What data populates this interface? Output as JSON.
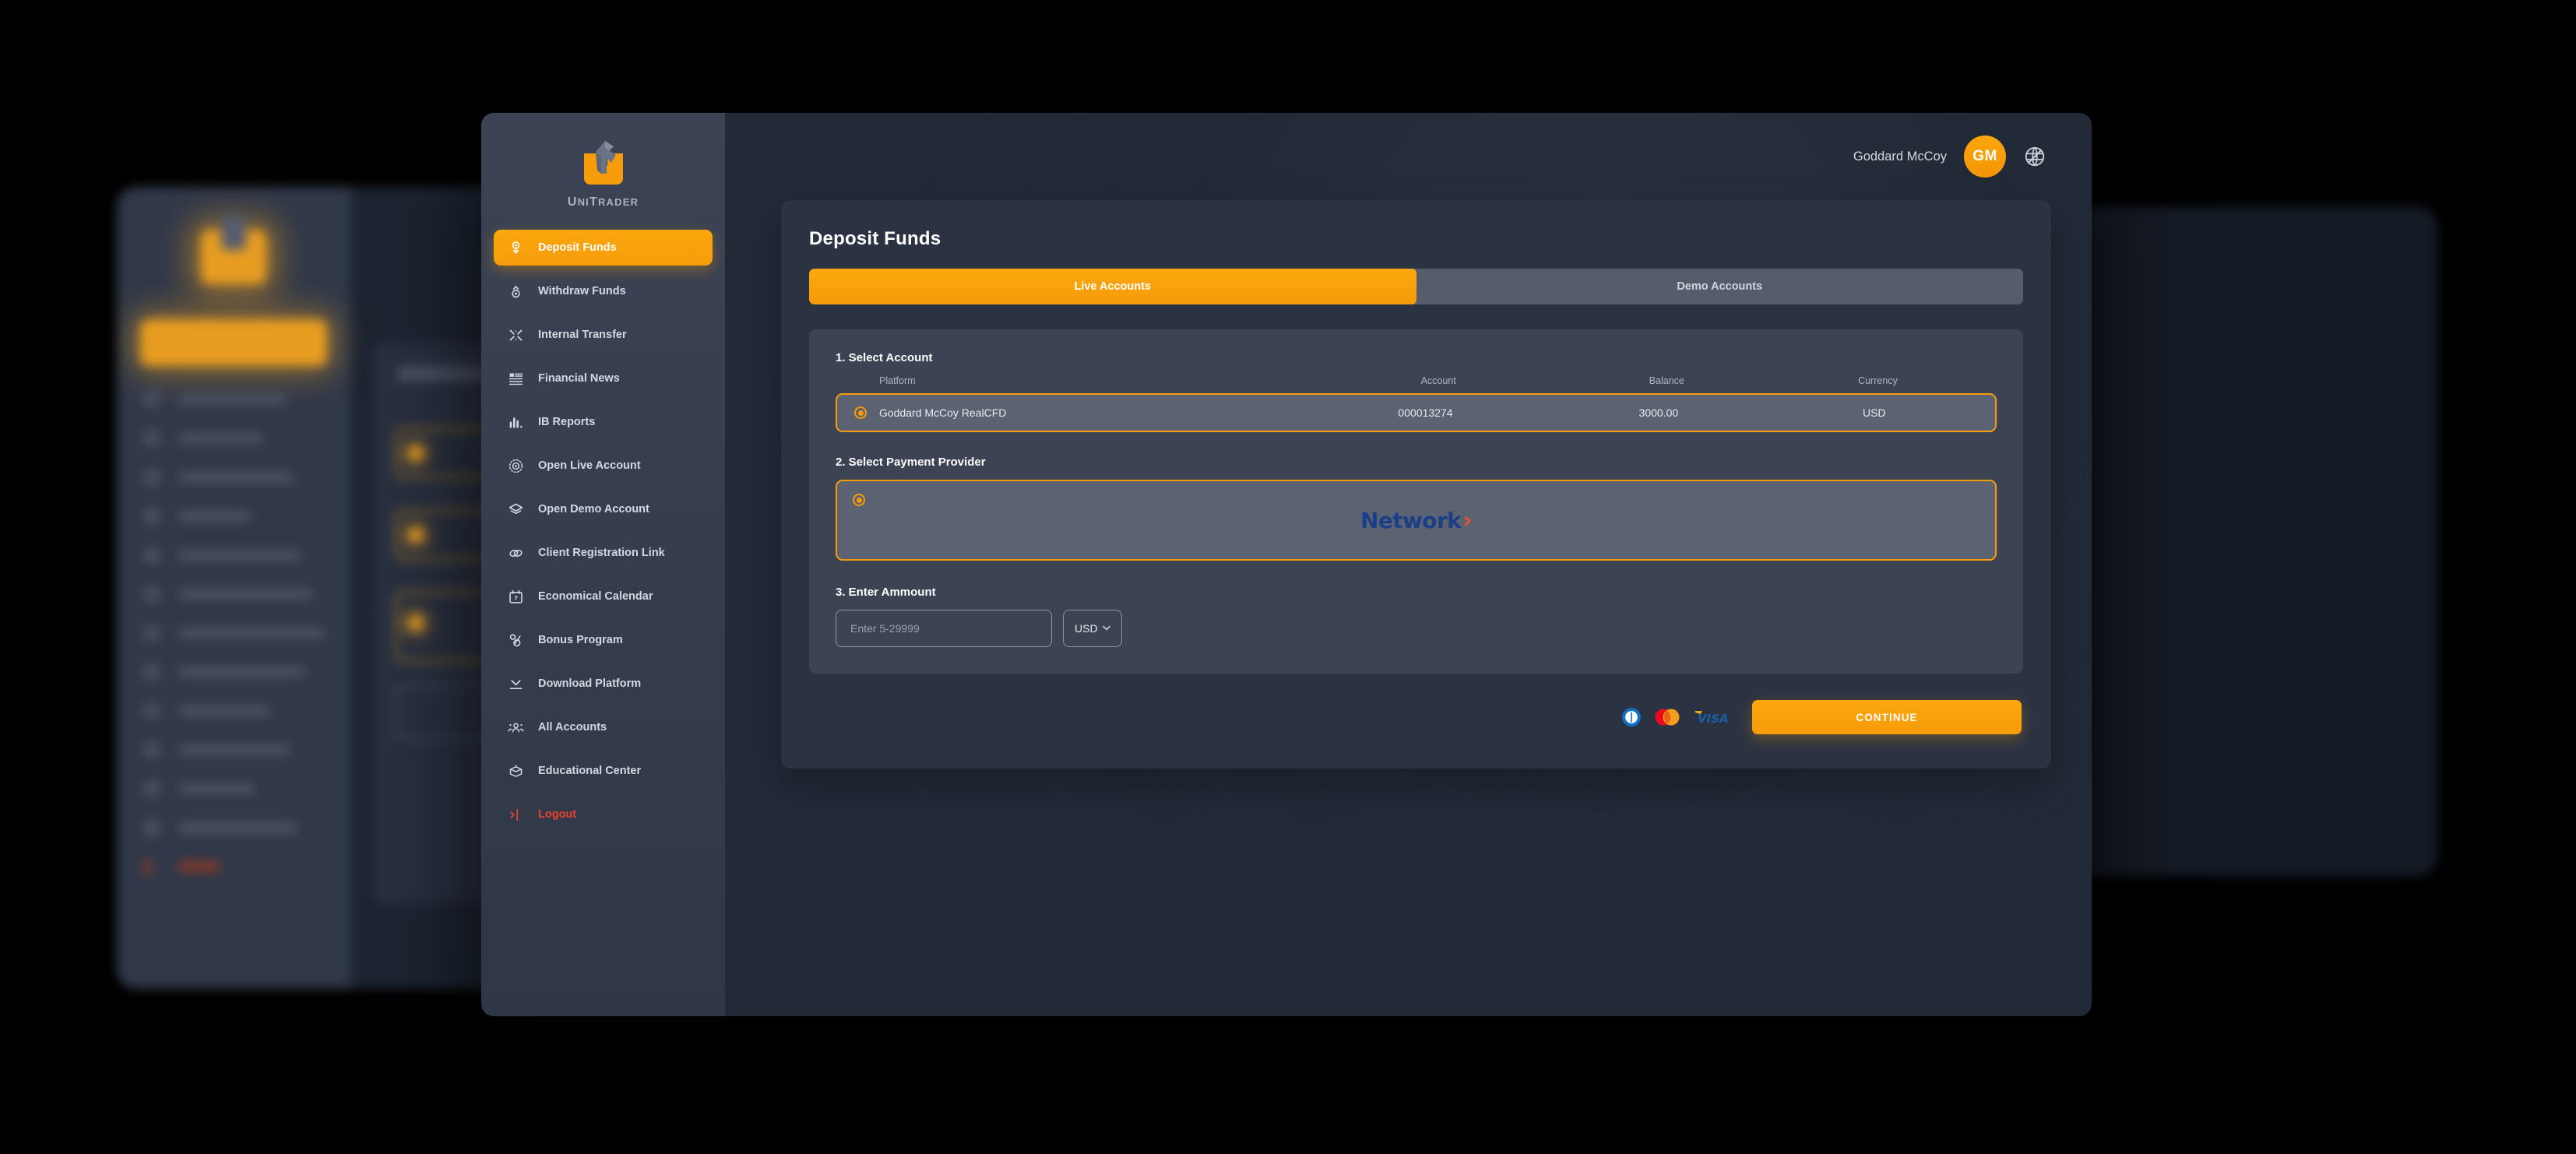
{
  "brand": {
    "name_upper_u": "U",
    "name_ni": "NI",
    "name_t": "T",
    "name_rader": "RADER",
    "full": "UNITRADER"
  },
  "sidebar": {
    "items": [
      {
        "label": "Deposit Funds",
        "icon": "deposit-funds-icon",
        "active": true
      },
      {
        "label": "Withdraw Funds",
        "icon": "withdraw-funds-icon",
        "active": false
      },
      {
        "label": "Internal Transfer",
        "icon": "internal-transfer-icon",
        "active": false
      },
      {
        "label": "Financial News",
        "icon": "financial-news-icon",
        "active": false
      },
      {
        "label": "IB Reports",
        "icon": "ib-reports-icon",
        "active": false
      },
      {
        "label": "Open Live Account",
        "icon": "open-live-account-icon",
        "active": false
      },
      {
        "label": "Open Demo Account",
        "icon": "open-demo-account-icon",
        "active": false
      },
      {
        "label": "Client Registration Link",
        "icon": "client-registration-link-icon",
        "active": false
      },
      {
        "label": "Economical Calendar",
        "icon": "economical-calendar-icon",
        "active": false
      },
      {
        "label": "Bonus Program",
        "icon": "bonus-program-icon",
        "active": false
      },
      {
        "label": "Download Platform",
        "icon": "download-platform-icon",
        "active": false
      },
      {
        "label": "All Accounts",
        "icon": "all-accounts-icon",
        "active": false
      },
      {
        "label": "Educational Center",
        "icon": "educational-center-icon",
        "active": false
      },
      {
        "label": "Logout",
        "icon": "logout-icon",
        "active": false
      }
    ]
  },
  "topbar": {
    "user_name": "Goddard McCoy",
    "avatar_initials": "GM",
    "language_icon": "globe-icon"
  },
  "main": {
    "page_title": "Deposit Funds",
    "tabs": [
      {
        "label": "Live Accounts",
        "active": true
      },
      {
        "label": "Demo Accounts",
        "active": false
      }
    ],
    "steps": {
      "select_account": "1. Select Account",
      "select_payment_provider": "2. Select Payment Provider",
      "enter_amount": "3.  Enter Ammount"
    },
    "account_table": {
      "columns": [
        "Platform",
        "Account",
        "Balance",
        "Currency"
      ],
      "rows": [
        {
          "platform": "Goddard McCoy RealCFD",
          "account": "000013274",
          "balance": "3000.00",
          "currency": "USD",
          "selected": true
        }
      ]
    },
    "payment_provider": {
      "name": "Network",
      "chevron": "›",
      "selected": true
    },
    "amount": {
      "value": "",
      "placeholder": "Enter 5-29999",
      "currency": "USD",
      "caret": "⌄"
    },
    "footer": {
      "card_icons": [
        "diners-club-icon",
        "mastercard-icon",
        "visa-icon"
      ],
      "visa_text": "VISA",
      "continue_label": "CONTINUE"
    }
  },
  "colors": {
    "accent": "#f79c0a",
    "accent_light": "#fba70d",
    "sidebar_bg": "#3b4354",
    "main_bg": "#222a38",
    "card_bg": "#2b3342",
    "panel_bg": "#3c4454",
    "row_bg": "#5b6272",
    "logout_red": "#e8412c",
    "network_blue": "#1b3f86",
    "network_orange": "#e8552f"
  }
}
